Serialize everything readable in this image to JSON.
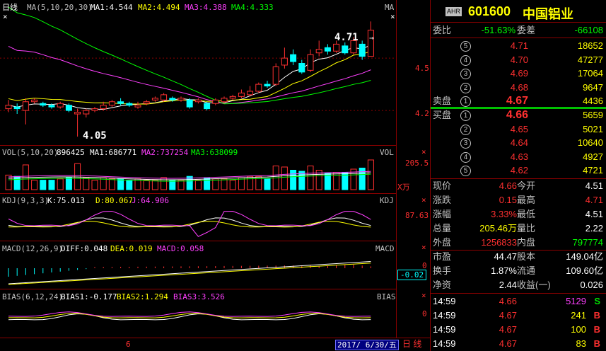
{
  "chart_header": {
    "period": "日线",
    "ma_label": "MA(5,10,20,30)",
    "ma1": "MA1:4.544",
    "ma2": "MA2:4.494",
    "ma3": "MA3:4.388",
    "ma4": "MA4:4.333",
    "right_tag": "MA"
  },
  "price_axis": {
    "p1": "4.5",
    "p2": "4.2"
  },
  "price_annotations": {
    "high": "4.71",
    "low": "4.05"
  },
  "vol_header": {
    "label": "VOL(5,10,20)",
    "value": "896425",
    "ma1": "MA1:686771",
    "ma2": "MA2:737254",
    "ma3": "MA3:638099",
    "right_tag": "VOL",
    "axis_value": "205.5",
    "unit": "X万"
  },
  "kdj_header": {
    "label": "KDJ(9,3,3)",
    "k": "K:75.013",
    "d": "D:80.067",
    "j": "J:64.906",
    "right_tag": "KDJ",
    "axis_value": "87.63"
  },
  "macd_header": {
    "label": "MACD(12,26,9)",
    "diff": "DIFF:0.048",
    "dea": "DEA:0.019",
    "macd": "MACD:0.058",
    "right_tag": "MACD",
    "axis_zero": "0",
    "axis_value": "-0.02"
  },
  "bias_header": {
    "label": "BIAS(6,12,24)",
    "b1": "BIAS1:-0.177",
    "b2": "BIAS2:1.294",
    "b3": "BIAS3:3.526",
    "right_tag": "BIAS",
    "axis_zero": "0"
  },
  "footer": {
    "month_mark": "6",
    "date": "2017/ 6/30/五",
    "period_tab": "日 线"
  },
  "stock": {
    "badge": "AHR",
    "code": "601600",
    "name": "中国铝业"
  },
  "order_ratio": {
    "label1": "委比",
    "value1": "-51.63%",
    "label2": "委差",
    "value2": "-66108"
  },
  "sell_label": "卖盘",
  "buy_label": "买盘",
  "asks": [
    {
      "level": "5",
      "price": "4.71",
      "volume": "18652"
    },
    {
      "level": "4",
      "price": "4.70",
      "volume": "47277"
    },
    {
      "level": "3",
      "price": "4.69",
      "volume": "17064"
    },
    {
      "level": "2",
      "price": "4.68",
      "volume": "9647"
    },
    {
      "level": "1",
      "price": "4.67",
      "volume": "4436"
    }
  ],
  "bids": [
    {
      "level": "1",
      "price": "4.66",
      "volume": "5659"
    },
    {
      "level": "2",
      "price": "4.65",
      "volume": "5021"
    },
    {
      "level": "3",
      "price": "4.64",
      "volume": "10640"
    },
    {
      "level": "4",
      "price": "4.63",
      "volume": "4927"
    },
    {
      "level": "5",
      "price": "4.62",
      "volume": "4721"
    }
  ],
  "quote": [
    {
      "l1": "现价",
      "v1": "4.66",
      "l2": "今开",
      "v2": "4.51"
    },
    {
      "l1": "涨跌",
      "v1": "0.15",
      "l2": "最高",
      "v2": "4.71"
    },
    {
      "l1": "涨幅",
      "v1": "3.33%",
      "l2": "最低",
      "v2": "4.51"
    },
    {
      "l1": "总量",
      "v1": "205.46万",
      "l2": "量比",
      "v2": "2.22"
    },
    {
      "l1": "外盘",
      "v1": "1256833",
      "l2": "内盘",
      "v2": "797774"
    }
  ],
  "fundamentals": [
    {
      "l1": "市盈",
      "v1": "44.47",
      "l2": "股本",
      "v2": "149.04亿"
    },
    {
      "l1": "换手",
      "v1": "1.87%",
      "l2": "流通",
      "v2": "109.60亿"
    },
    {
      "l1": "净资",
      "v1": "2.44",
      "l2": "收益(一)",
      "v2": "0.026"
    }
  ],
  "ticks": [
    {
      "time": "14:59",
      "price": "4.66",
      "vol": "5129",
      "side": "S"
    },
    {
      "time": "14:59",
      "price": "4.67",
      "vol": "241",
      "side": "B"
    },
    {
      "time": "14:59",
      "price": "4.67",
      "vol": "100",
      "side": "B"
    },
    {
      "time": "14:59",
      "price": "4.67",
      "vol": "83",
      "side": "B"
    }
  ],
  "colors": {
    "up": "#ff3030",
    "down": "#00ffff",
    "ma1": "#ffffff",
    "ma2": "#ffff00",
    "ma3": "#ff40ff",
    "ma4": "#00ff00",
    "border": "#8b0000"
  },
  "chart_data": [
    {
      "type": "candlestick",
      "title": "",
      "series_desc": "daily K-line with MA5/10/20/30",
      "ylim": [
        4.03,
        4.76
      ],
      "candles": [
        {
          "o": 4.21,
          "c": 4.23,
          "h": 4.26,
          "l": 4.19
        },
        {
          "o": 4.22,
          "c": 4.21,
          "h": 4.24,
          "l": 4.18
        },
        {
          "o": 4.2,
          "c": 4.25,
          "h": 4.27,
          "l": 4.12
        },
        {
          "o": 4.25,
          "c": 4.26,
          "h": 4.27,
          "l": 4.24
        },
        {
          "o": 4.24,
          "c": 4.23,
          "h": 4.25,
          "l": 4.22
        },
        {
          "o": 4.23,
          "c": 4.22,
          "h": 4.24,
          "l": 4.21
        },
        {
          "o": 4.22,
          "c": 4.24,
          "h": 4.25,
          "l": 4.21
        },
        {
          "o": 4.23,
          "c": 4.2,
          "h": 4.24,
          "l": 4.19
        },
        {
          "o": 4.18,
          "c": 4.19,
          "h": 4.21,
          "l": 4.05
        },
        {
          "o": 4.18,
          "c": 4.2,
          "h": 4.21,
          "l": 4.16
        },
        {
          "o": 4.2,
          "c": 4.21,
          "h": 4.22,
          "l": 4.19
        },
        {
          "o": 4.21,
          "c": 4.23,
          "h": 4.25,
          "l": 4.2
        },
        {
          "o": 4.23,
          "c": 4.25,
          "h": 4.26,
          "l": 4.22
        },
        {
          "o": 4.25,
          "c": 4.24,
          "h": 4.27,
          "l": 4.23
        },
        {
          "o": 4.24,
          "c": 4.23,
          "h": 4.25,
          "l": 4.22
        },
        {
          "o": 4.22,
          "c": 4.23,
          "h": 4.25,
          "l": 4.21
        },
        {
          "o": 4.24,
          "c": 4.25,
          "h": 4.26,
          "l": 4.23
        },
        {
          "o": 4.26,
          "c": 4.27,
          "h": 4.28,
          "l": 4.25
        },
        {
          "o": 4.26,
          "c": 4.29,
          "h": 4.3,
          "l": 4.25
        },
        {
          "o": 4.27,
          "c": 4.26,
          "h": 4.28,
          "l": 4.25
        },
        {
          "o": 4.26,
          "c": 4.27,
          "h": 4.28,
          "l": 4.25
        },
        {
          "o": 4.26,
          "c": 4.22,
          "h": 4.27,
          "l": 4.21
        },
        {
          "o": 4.25,
          "c": 4.26,
          "h": 4.27,
          "l": 4.24
        },
        {
          "o": 4.24,
          "c": 4.21,
          "h": 4.25,
          "l": 4.2
        },
        {
          "o": 4.24,
          "c": 4.26,
          "h": 4.27,
          "l": 4.23
        },
        {
          "o": 4.25,
          "c": 4.27,
          "h": 4.28,
          "l": 4.24
        },
        {
          "o": 4.27,
          "c": 4.28,
          "h": 4.29,
          "l": 4.26
        },
        {
          "o": 4.28,
          "c": 4.3,
          "h": 4.32,
          "l": 4.27
        },
        {
          "o": 4.29,
          "c": 4.31,
          "h": 4.34,
          "l": 4.28
        },
        {
          "o": 4.31,
          "c": 4.35,
          "h": 4.36,
          "l": 4.3
        },
        {
          "o": 4.35,
          "c": 4.34,
          "h": 4.37,
          "l": 4.33
        },
        {
          "o": 4.35,
          "c": 4.45,
          "h": 4.47,
          "l": 4.34
        },
        {
          "o": 4.46,
          "c": 4.5,
          "h": 4.56,
          "l": 4.44
        },
        {
          "o": 4.52,
          "c": 4.48,
          "h": 4.55,
          "l": 4.46
        },
        {
          "o": 4.47,
          "c": 4.42,
          "h": 4.49,
          "l": 4.41
        },
        {
          "o": 4.43,
          "c": 4.52,
          "h": 4.55,
          "l": 4.42
        },
        {
          "o": 4.53,
          "c": 4.55,
          "h": 4.6,
          "l": 4.51
        },
        {
          "o": 4.56,
          "c": 4.54,
          "h": 4.58,
          "l": 4.52
        },
        {
          "o": 4.54,
          "c": 4.58,
          "h": 4.6,
          "l": 4.53
        },
        {
          "o": 4.57,
          "c": 4.53,
          "h": 4.59,
          "l": 4.52
        },
        {
          "o": 4.53,
          "c": 4.6,
          "h": 4.62,
          "l": 4.52
        },
        {
          "o": 4.58,
          "c": 4.51,
          "h": 4.6,
          "l": 4.49
        },
        {
          "o": 4.51,
          "c": 4.66,
          "h": 4.71,
          "l": 4.51
        }
      ]
    }
  ]
}
